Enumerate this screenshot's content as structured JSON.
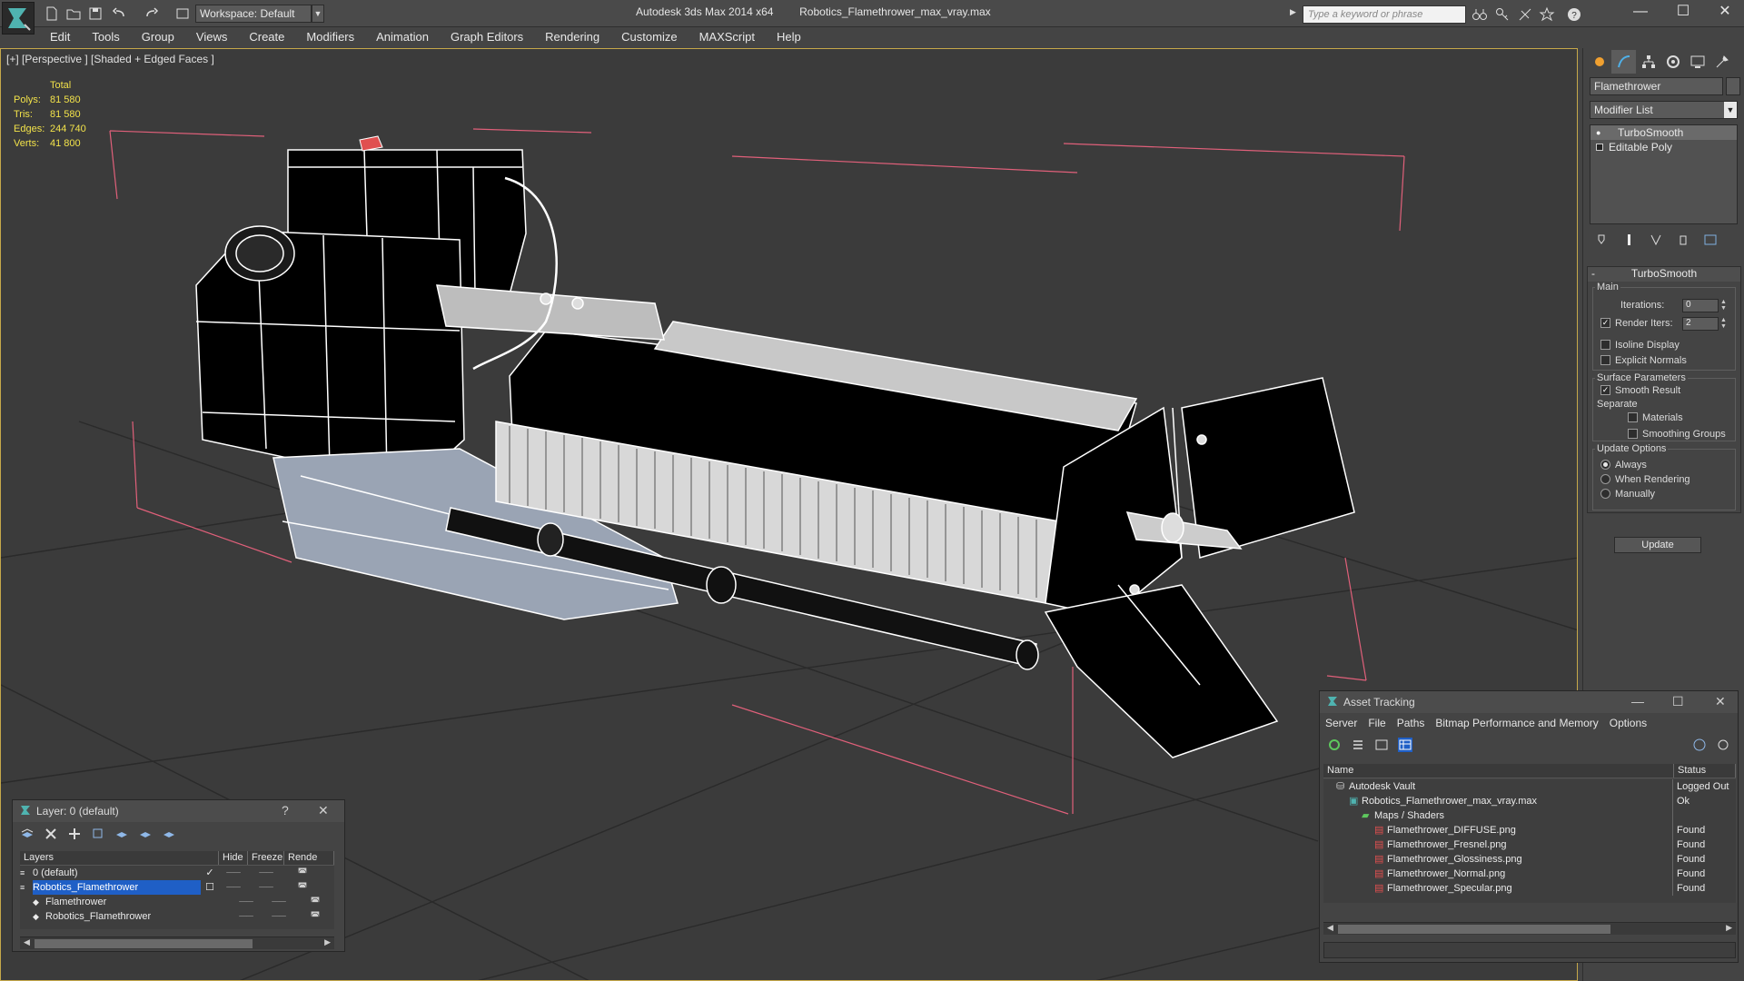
{
  "titlebar": {
    "app_title": "Autodesk 3ds Max  2014 x64",
    "file_name": "Robotics_Flamethrower_max_vray.max",
    "workspace": "Workspace: Default",
    "search_placeholder": "Type a keyword or phrase"
  },
  "menu": [
    "Edit",
    "Tools",
    "Group",
    "Views",
    "Create",
    "Modifiers",
    "Animation",
    "Graph Editors",
    "Rendering",
    "Customize",
    "MAXScript",
    "Help"
  ],
  "viewport": {
    "label": "[+] [Perspective ] [Shaded + Edged Faces ]",
    "stats_header": "Total",
    "stats": [
      {
        "k": "Polys:",
        "v": "81 580"
      },
      {
        "k": "Tris:",
        "v": "81 580"
      },
      {
        "k": "Edges:",
        "v": "244 740"
      },
      {
        "k": "Verts:",
        "v": "41 800"
      }
    ]
  },
  "command_panel": {
    "object_name": "Flamethrower",
    "modifier_list": "Modifier List",
    "stack": [
      "TurboSmooth",
      "Editable Poly"
    ],
    "rollout": {
      "title": "TurboSmooth",
      "main_group": "Main",
      "iterations_label": "Iterations:",
      "iterations_value": "0",
      "render_iters_label": "Render Iters:",
      "render_iters_value": "2",
      "render_iters_checked": true,
      "isoline_display": "Isoline Display",
      "explicit_normals": "Explicit Normals",
      "surface_params": "Surface Parameters",
      "smooth_result": "Smooth Result",
      "separate": "Separate",
      "materials": "Materials",
      "smoothing_groups": "Smoothing Groups",
      "update_options": "Update Options",
      "always": "Always",
      "when_rendering": "When Rendering",
      "manually": "Manually",
      "update_button": "Update"
    }
  },
  "layer_window": {
    "title": "Layer: 0 (default)",
    "help": "?",
    "columns": [
      "Layers",
      "Hide",
      "Freeze",
      "Rende"
    ],
    "rows": [
      {
        "name": "0 (default)",
        "indent": 1,
        "selected": false
      },
      {
        "name": "Robotics_Flamethrower",
        "indent": 1,
        "selected": true
      },
      {
        "name": "Flamethrower",
        "indent": 2,
        "selected": false
      },
      {
        "name": "Robotics_Flamethrower",
        "indent": 2,
        "selected": false
      }
    ]
  },
  "asset_window": {
    "title": "Asset Tracking",
    "menu": [
      "Server",
      "File",
      "Paths",
      "Bitmap Performance and Memory",
      "Options"
    ],
    "columns": [
      "Name",
      "Status"
    ],
    "rows": [
      {
        "name": "Autodesk Vault",
        "status": "Logged Out",
        "indent": 1,
        "icon": "vault"
      },
      {
        "name": "Robotics_Flamethrower_max_vray.max",
        "status": "Ok",
        "indent": 2,
        "icon": "max"
      },
      {
        "name": "Maps / Shaders",
        "status": "",
        "indent": 3,
        "icon": "maps"
      },
      {
        "name": "Flamethrower_DIFFUSE.png",
        "status": "Found",
        "indent": 4,
        "icon": "png"
      },
      {
        "name": "Flamethrower_Fresnel.png",
        "status": "Found",
        "indent": 4,
        "icon": "png"
      },
      {
        "name": "Flamethrower_Glossiness.png",
        "status": "Found",
        "indent": 4,
        "icon": "png"
      },
      {
        "name": "Flamethrower_Normal.png",
        "status": "Found",
        "indent": 4,
        "icon": "png"
      },
      {
        "name": "Flamethrower_Specular.png",
        "status": "Found",
        "indent": 4,
        "icon": "png"
      }
    ]
  },
  "colors": {
    "accent_blue": "#1f5fc6",
    "stats_yellow": "#f2e24a",
    "viewport_border": "#c6a84a",
    "bbox_pink": "#e0607a"
  }
}
